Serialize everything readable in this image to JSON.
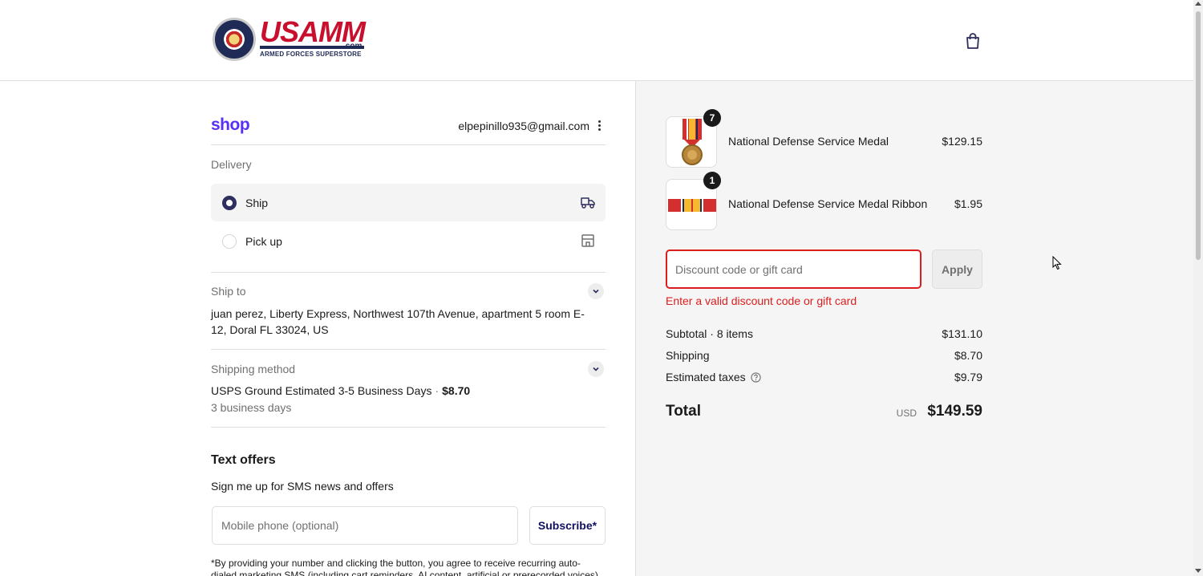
{
  "header": {
    "logo": {
      "main": "USAMM",
      "domain": ".com",
      "tagline": "ARMED FORCES SUPERSTORE"
    },
    "cart_icon": "shopping-bag-icon"
  },
  "account": {
    "shop_logo": "shop",
    "email": "elpepinillo935@gmail.com",
    "menu_icon": "kebab-menu-icon"
  },
  "delivery": {
    "label": "Delivery",
    "options": [
      {
        "label": "Ship",
        "selected": true,
        "icon": "truck-icon"
      },
      {
        "label": "Pick up",
        "selected": false,
        "icon": "store-icon"
      }
    ]
  },
  "ship_to": {
    "label": "Ship to",
    "address": "juan perez, Liberty Express, Northwest 107th Avenue, apartment 5 room E-12, Doral FL 33024, US"
  },
  "shipping_method": {
    "label": "Shipping method",
    "name": "USPS Ground Estimated 3-5 Business Days",
    "separator": "·",
    "price": "$8.70",
    "eta": "3 business days"
  },
  "text_offers": {
    "title": "Text offers",
    "subtitle": "Sign me up for SMS news and offers",
    "phone_placeholder": "Mobile phone (optional)",
    "subscribe_label": "Subscribe*",
    "disclaimer": "*By providing your number and clicking the button, you agree to receive recurring auto-dialed marketing SMS (including cart reminders, AI content, artificial or prerecorded voices) and our"
  },
  "order_summary": {
    "items": [
      {
        "name": "National Defense Service Medal",
        "price": "$129.15",
        "quantity": "7"
      },
      {
        "name": "National Defense Service Medal Ribbon",
        "price": "$1.95",
        "quantity": "1"
      }
    ],
    "discount": {
      "placeholder": "Discount code or gift card",
      "apply_label": "Apply",
      "error": "Enter a valid discount code or gift card"
    },
    "subtotal_label": "Subtotal · 8 items",
    "subtotal_value": "$131.10",
    "shipping_label": "Shipping",
    "shipping_value": "$8.70",
    "taxes_label": "Estimated taxes",
    "taxes_value": "$9.79",
    "total_label": "Total",
    "total_currency": "USD",
    "total_value": "$149.59"
  },
  "colors": {
    "shop_brand": "#5a31f4",
    "error": "#dd1d1d",
    "radio_selected": "#2e2e5f",
    "logo_red": "#c8102e",
    "logo_navy": "#1f2a56"
  }
}
